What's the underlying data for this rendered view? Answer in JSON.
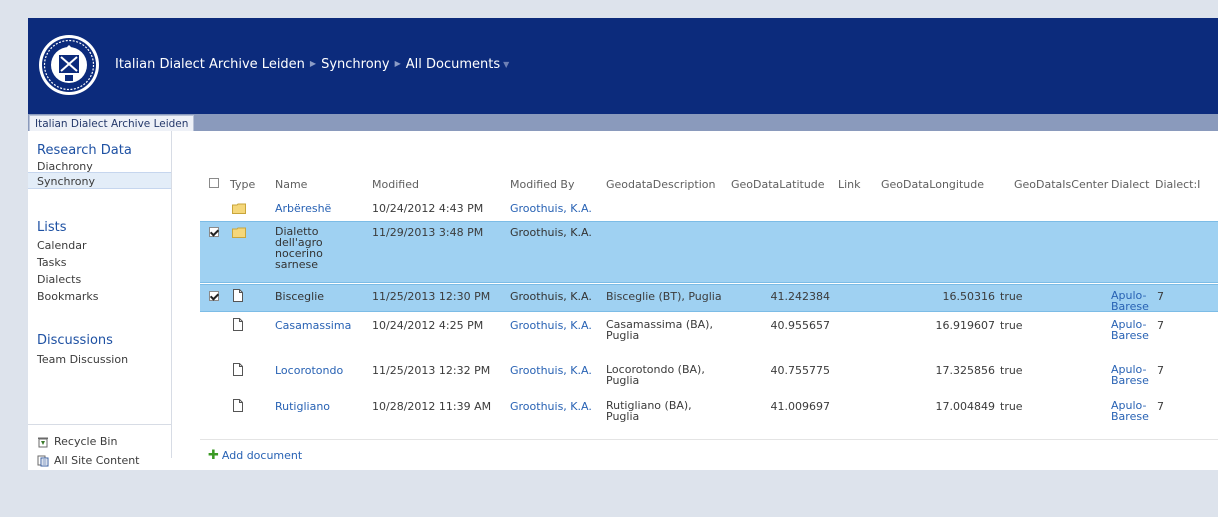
{
  "header": {
    "breadcrumb": [
      "Italian Dialect Archive Leiden",
      "Synchrony",
      "All Documents"
    ]
  },
  "topnav": {
    "tab": "Italian Dialect Archive Leiden"
  },
  "quicklaunch": {
    "research_data": {
      "heading": "Research Data",
      "items": [
        "Diachrony",
        "Synchrony"
      ]
    },
    "lists": {
      "heading": "Lists",
      "items": [
        "Calendar",
        "Tasks",
        "Dialects",
        "Bookmarks"
      ]
    },
    "discussions": {
      "heading": "Discussions",
      "items": [
        "Team Discussion"
      ]
    },
    "recycle_bin": "Recycle Bin",
    "all_site_content": "All Site Content"
  },
  "list": {
    "columns": [
      "Type",
      "Name",
      "Modified",
      "Modified By",
      "GeodataDescription",
      "GeoDataLatitude",
      "Link",
      "GeoDataLongitude",
      "GeoDataIsCenter",
      "Dialect",
      "Dialect:I"
    ],
    "rows": [
      {
        "type": "folder",
        "name": "Arbëreshë",
        "modified": "10/24/2012 4:43 PM",
        "modified_by": "Groothuis, K.A.",
        "desc": "",
        "lat": "",
        "lon": "",
        "center": "",
        "dialect": "",
        "dialect_id": "",
        "selected": false
      },
      {
        "type": "folder",
        "name": "Dialetto dell'agro nocerino sarnese",
        "modified": "11/29/2013 3:48 PM",
        "modified_by": "Groothuis, K.A.",
        "desc": "",
        "lat": "",
        "lon": "",
        "center": "",
        "dialect": "",
        "dialect_id": "",
        "selected": true
      },
      {
        "type": "file",
        "name": "Bisceglie",
        "modified": "11/25/2013 12:30 PM",
        "modified_by": "Groothuis, K.A.",
        "desc": "Bisceglie (BT), Puglia",
        "lat": "41.242384",
        "lon": "16.50316",
        "center": "true",
        "dialect": "Apulo-Barese",
        "dialect_id": "7",
        "selected": true
      },
      {
        "type": "file",
        "name": "Casamassima",
        "modified": "10/24/2012 4:25 PM",
        "modified_by": "Groothuis, K.A.",
        "desc": "Casamassima (BA), Puglia",
        "lat": "40.955657",
        "lon": "16.919607",
        "center": "true",
        "dialect": "Apulo-Barese",
        "dialect_id": "7",
        "selected": false
      },
      {
        "type": "file",
        "name": "Locorotondo",
        "modified": "11/25/2013 12:32 PM",
        "modified_by": "Groothuis, K.A.",
        "desc": "Locorotondo (BA), Puglia",
        "lat": "40.755775",
        "lon": "17.325856",
        "center": "true",
        "dialect": "Apulo-Barese",
        "dialect_id": "7",
        "selected": false
      },
      {
        "type": "file",
        "name": "Rutigliano",
        "modified": "10/28/2012 11:39 AM",
        "modified_by": "Groothuis, K.A.",
        "desc": "Rutigliano (BA), Puglia",
        "lat": "41.009697",
        "lon": "17.004849",
        "center": "true",
        "dialect": "Apulo-Barese",
        "dialect_id": "7",
        "selected": false
      }
    ]
  },
  "add_document": "Add document",
  "colors": {
    "header_bg": "#0c2b7c",
    "selected_row": "#9fd1f2",
    "link": "#2862b4",
    "heading": "#1e51a3"
  }
}
